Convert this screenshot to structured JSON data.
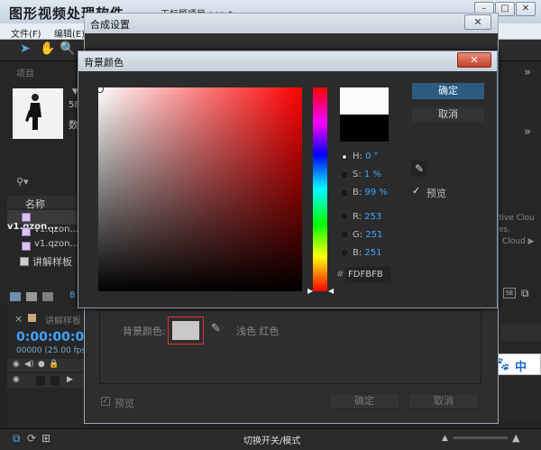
{
  "app": {
    "watermark": "图形视频处理软件",
    "document_title": "无标题项目.aep *",
    "window_buttons": [
      "–",
      "□",
      "✕"
    ],
    "menu": [
      "文件(F)",
      "编辑(E)"
    ]
  },
  "project_panel": {
    "title": "项目",
    "thumb_count": "58",
    "thumb_label": "数",
    "search_icon": "search-icon",
    "column_name": "名称",
    "items": [
      {
        "name": "v1.qzon...",
        "icon": "file-icon"
      },
      {
        "name": "v1.qzon...",
        "icon": "file-icon"
      },
      {
        "name": "v1.qzon...",
        "icon": "file-icon"
      },
      {
        "name": "讲解样板",
        "icon": "composition-icon"
      }
    ],
    "bpc": "8"
  },
  "timeline": {
    "close": "×",
    "comp_name": "讲解样板",
    "timecode": "0:00:00:00",
    "frames": "00000 (25.00 fps)"
  },
  "status_bar": {
    "toggle_label": "切换开关/模式"
  },
  "right_panel": {
    "chevron": "»",
    "cc_text_1": "tive Clou",
    "cc_text_2": "es.",
    "cc_text_3": "Cloud ▶"
  },
  "ime": {
    "lang": "中",
    "paw": "🐾"
  },
  "comp_settings": {
    "title": "合成设置",
    "close": "✕",
    "bg_color_label": "背景颜色:",
    "preset_name": "浅色 红色",
    "preview_label": "预览",
    "ok_label": "确定",
    "cancel_label": "取消",
    "swatch_color": "#c9c9c9"
  },
  "color_picker": {
    "title": "背景颜色",
    "close": "✕",
    "ok_label": "确定",
    "cancel_label": "取消",
    "new_color": "#fdfbfb",
    "old_color": "#000000",
    "fields": [
      {
        "label": "H:",
        "value": "0 °"
      },
      {
        "label": "S:",
        "value": "1 %"
      },
      {
        "label": "B:",
        "value": "99 %"
      },
      {
        "label": "R:",
        "value": "253"
      },
      {
        "label": "G:",
        "value": "251"
      },
      {
        "label": "B:",
        "value": "251"
      }
    ],
    "hex_prefix": "#",
    "hex": "FDFBFB",
    "preview_label": "预览",
    "preview_checked": true,
    "selected_channel": "H"
  }
}
